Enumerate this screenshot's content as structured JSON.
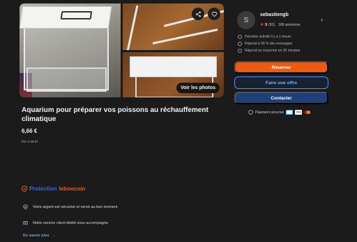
{
  "listing": {
    "title": "Aquarium pour préparer vos poissons au réchauffement climatique",
    "price": "6,66 €",
    "date": "hier à 08:57",
    "see_photos_label": "Voir les photos"
  },
  "seller": {
    "initial": "S",
    "name": "sebastiengb",
    "rating_value": "5",
    "rating_count": "(91)",
    "ads_count": "166 annonces",
    "info": [
      "Dernière activité il y a 1 heure",
      "Répond à 99 % des messages",
      "Répond en moyenne en 30 minutes"
    ]
  },
  "actions": {
    "reserve": "Réserver",
    "offer": "Faire une offre",
    "contact": "Contacter"
  },
  "payment": {
    "label": "Paiement sécurisé",
    "cards": [
      "CB",
      "VISA",
      "Mastercard"
    ]
  },
  "protection": {
    "word": "Protection",
    "brand": "leboncoin",
    "items": [
      "Votre argent est sécurisé et versé au bon moment",
      "Notre service client dédié vous accompagne"
    ],
    "learn_more": "En savoir plus",
    "learn_more_arrow": "→"
  },
  "colors": {
    "accent": "#ec5a13",
    "primary": "#1e3f7a",
    "background": "#1b1b1b",
    "link": "#6aa0ff"
  },
  "icons": [
    "share-icon",
    "heart-icon",
    "star-icon",
    "chevron-right-icon",
    "clock-icon",
    "message-icon",
    "timer-icon",
    "shield-icon",
    "lock-icon",
    "support-icon"
  ]
}
